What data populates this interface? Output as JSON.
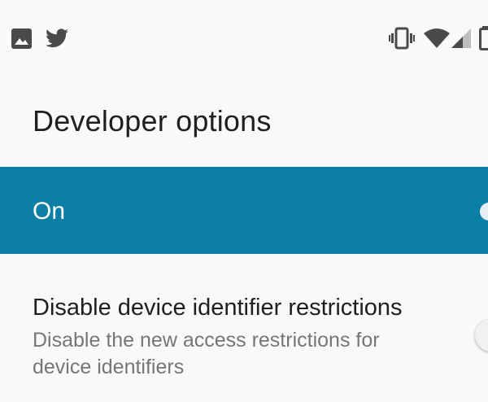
{
  "status_bar": {
    "left_icons": [
      "image-icon",
      "twitter-icon"
    ],
    "right_icons": [
      "vibrate-icon",
      "wifi-icon",
      "signal-icon",
      "battery-icon"
    ]
  },
  "page": {
    "title": "Developer options"
  },
  "master_switch": {
    "label": "On",
    "checked": true,
    "color": "#0b7fa5"
  },
  "settings": [
    {
      "title": "Disable device identifier restrictions",
      "summary": "Disable the new access restrictions for device identifiers",
      "checked": false
    }
  ]
}
